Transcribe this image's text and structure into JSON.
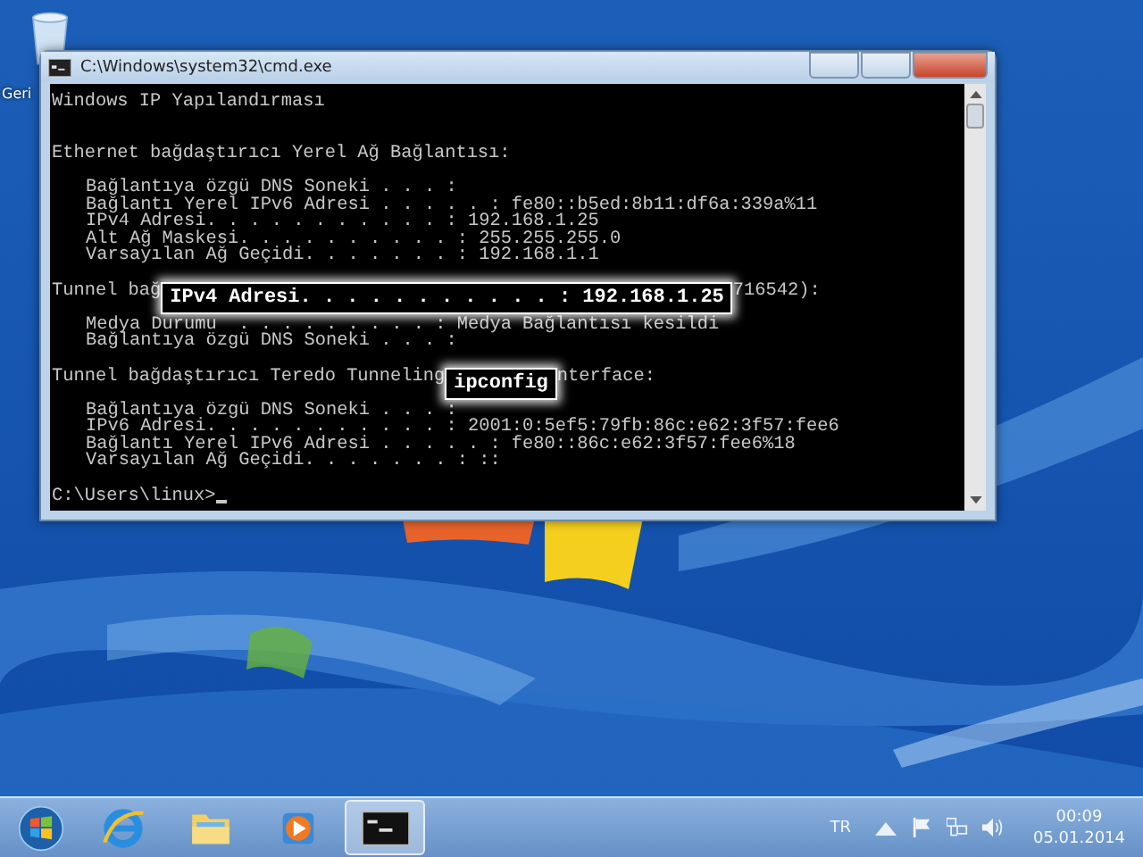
{
  "desktop": {
    "icons": [
      {
        "label": "Geri"
      }
    ]
  },
  "window": {
    "title": "C:\\Windows\\system32\\cmd.exe",
    "lines": [
      {
        "kind": "text",
        "segments": [
          {
            "kind": "text",
            "text": "Windows IP Yapılandırması"
          }
        ]
      },
      {
        "kind": "blank"
      },
      {
        "kind": "blank"
      },
      {
        "kind": "text",
        "segments": [
          {
            "kind": "text",
            "text": "Ethernet bağdaştırıcı Yerel Ağ Bağlantısı:"
          }
        ]
      },
      {
        "kind": "blank"
      },
      {
        "kind": "text",
        "indented": true,
        "segments": [
          {
            "kind": "text",
            "text": "Bağlantıya özgü DNS Soneki . . . :"
          }
        ]
      },
      {
        "kind": "text",
        "indented": true,
        "segments": [
          {
            "kind": "text",
            "text": "Bağlantı Yerel IPv6 Adresi . . . . . : fe80::b5ed:8b11:df6a:339a%11"
          }
        ]
      },
      {
        "kind": "text",
        "indented": true,
        "segments": [
          {
            "kind": "text",
            "text": "IPv4 Adresi. . . . . . . . . . . : 192.168.1.25"
          }
        ]
      },
      {
        "kind": "text",
        "indented": true,
        "segments": [
          {
            "kind": "text",
            "text": "Alt Ağ Maskesi. . . . . . . . . . : 255.255.255.0"
          }
        ]
      },
      {
        "kind": "text",
        "indented": true,
        "segments": [
          {
            "kind": "text",
            "text": "Varsayılan Ağ Geçidi. . . . . . . : 192.168.1.1"
          }
        ]
      },
      {
        "kind": "blank"
      },
      {
        "kind": "text",
        "segments": [
          {
            "kind": "text",
            "text": "Tunnel bağ"
          },
          {
            "kind": "callout",
            "text": "IPv4 Adresi. . . . . . . . . . . : 192.168.1.25"
          },
          {
            "kind": "text",
            "text": "716542):"
          }
        ]
      },
      {
        "kind": "blank"
      },
      {
        "kind": "text",
        "indented": true,
        "segments": [
          {
            "kind": "text",
            "text": "Medya Durumu  . . . . . . . . . : Medya Bağlantısı kesildi"
          }
        ]
      },
      {
        "kind": "text",
        "indented": true,
        "segments": [
          {
            "kind": "text",
            "text": "Bağlantıya özgü DNS Soneki . . . :"
          }
        ]
      },
      {
        "kind": "blank"
      },
      {
        "kind": "text",
        "segments": [
          {
            "kind": "text",
            "text": "Tunnel bağdaştırıcı Teredo Tunneling"
          },
          {
            "kind": "callout",
            "text": "ipconfig"
          },
          {
            "kind": "text",
            "text": "nterface:"
          }
        ]
      },
      {
        "kind": "blank"
      },
      {
        "kind": "text",
        "indented": true,
        "segments": [
          {
            "kind": "text",
            "text": "Bağlantıya özgü DNS Soneki . . . :"
          }
        ]
      },
      {
        "kind": "text",
        "indented": true,
        "segments": [
          {
            "kind": "text",
            "text": "IPv6 Adresi. . . . . . . . . . . : 2001:0:5ef5:79fb:86c:e62:3f57:fee6"
          }
        ]
      },
      {
        "kind": "text",
        "indented": true,
        "segments": [
          {
            "kind": "text",
            "text": "Bağlantı Yerel IPv6 Adresi . . . . . : fe80::86c:e62:3f57:fee6%18"
          }
        ]
      },
      {
        "kind": "text",
        "indented": true,
        "segments": [
          {
            "kind": "text",
            "text": "Varsayılan Ağ Geçidi. . . . . . . : ::"
          }
        ]
      },
      {
        "kind": "blank"
      },
      {
        "kind": "prompt",
        "segments": [
          {
            "kind": "text",
            "text": "C:\\Users\\linux>"
          }
        ]
      }
    ]
  },
  "taskbar": {
    "buttons": [
      {
        "kind": "start",
        "selected": false
      },
      {
        "kind": "browser",
        "selected": false
      },
      {
        "kind": "folder",
        "selected": false
      },
      {
        "kind": "media",
        "selected": false
      },
      {
        "kind": "console",
        "selected": true
      }
    ],
    "language": "TR",
    "clock": {
      "time": "00:09",
      "date": "05.01.2014"
    }
  }
}
